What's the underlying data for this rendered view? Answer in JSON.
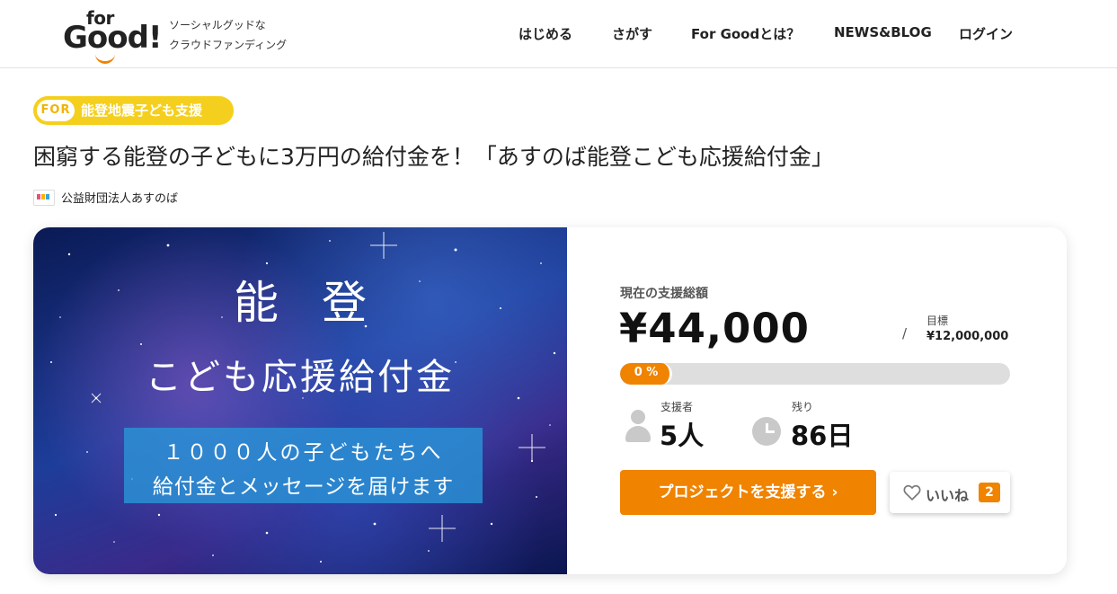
{
  "header": {
    "logo_for": "for",
    "logo_good": "Good!",
    "tagline_line1": "ソーシャルグッドな",
    "tagline_line2": "クラウドファンディング",
    "nav": {
      "start": "はじめる",
      "search": "さがす",
      "about": "For Goodとは？",
      "news": "NEWS&BLOG",
      "login": "ログイン"
    }
  },
  "project": {
    "badge_for": "FOR",
    "category": "能登地震子ども支援",
    "title": "困窮する能登の子どもに3万円の給付金を！「あすのば能登こども応援給付金」",
    "organization": "公益財団法人あすのば",
    "hero": {
      "line1": "能登",
      "line2": "こども応援給付金",
      "box_line1": "１０００人の子どもたちへ",
      "box_line2": "給付金とメッセージを届けます"
    }
  },
  "stats": {
    "total_label": "現在の支援総額",
    "total_amount": "¥44,000",
    "separator": "/",
    "goal_label": "目標",
    "goal_amount": "¥12,000,000",
    "progress_text": "0 %",
    "progress_fraction": 0.0037,
    "supporters_label": "支援者",
    "supporters_value": "5人",
    "remaining_label": "残り",
    "remaining_value": "86日"
  },
  "actions": {
    "support_label": "プロジェクトを支援する ›",
    "like_label": "いいね",
    "like_count": "2"
  },
  "colors": {
    "accent": "#f08300",
    "badge": "#f5cf1d",
    "hero_box": "#2994d7",
    "muted_icon": "#c9c9c9"
  },
  "icons": [
    "person-icon",
    "clock-icon",
    "heart-icon",
    "chevron-right-icon",
    "org-logo-icon"
  ]
}
